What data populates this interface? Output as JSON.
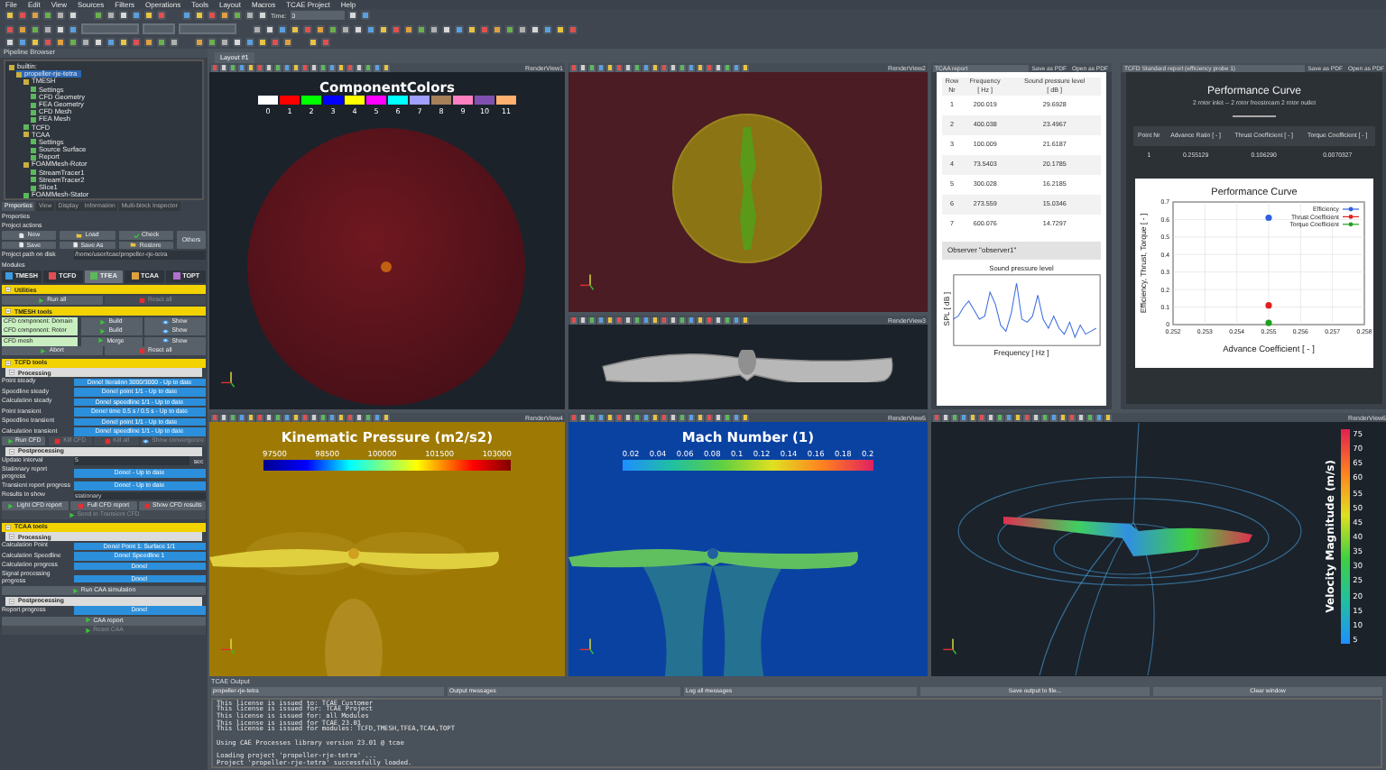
{
  "menu": [
    "File",
    "Edit",
    "View",
    "Sources",
    "Filters",
    "Operations",
    "Tools",
    "Layout",
    "Macros",
    "TCAE Project",
    "Help"
  ],
  "toolbar": {
    "time_label": "Time:",
    "time_value": "0"
  },
  "pipeline": {
    "title": "Pipeline Browser",
    "items": [
      {
        "label": "builtin:",
        "selected": false,
        "children": [
          {
            "label": "propeller-rje-tetra",
            "selected": true,
            "children": [
              {
                "label": "TMESH",
                "selected": false,
                "children": [
                  {
                    "label": "Settings",
                    "selected": false
                  },
                  {
                    "label": "CFD Geometry",
                    "selected": false
                  },
                  {
                    "label": "FEA Geometry",
                    "selected": false
                  },
                  {
                    "label": "CFD Mesh",
                    "selected": false
                  },
                  {
                    "label": "FEA Mesh",
                    "selected": false
                  }
                ]
              },
              {
                "label": "TCFD",
                "selected": false
              },
              {
                "label": "TCAA",
                "selected": false,
                "children": [
                  {
                    "label": "Settings",
                    "selected": false
                  },
                  {
                    "label": "Source Surface",
                    "selected": false
                  },
                  {
                    "label": "Report",
                    "selected": false
                  }
                ]
              },
              {
                "label": "FOAMMesh-Rotor",
                "selected": false,
                "children": [
                  {
                    "label": "StreamTracer1",
                    "selected": false
                  },
                  {
                    "label": "StreamTracer2",
                    "selected": false
                  },
                  {
                    "label": "Slice1",
                    "selected": false
                  }
                ]
              },
              {
                "label": "FOAMMesh-Stator",
                "selected": false
              }
            ]
          }
        ]
      }
    ]
  },
  "properties": {
    "tabs": [
      {
        "label": "Properties",
        "selected": true
      },
      {
        "label": "View",
        "selected": false
      },
      {
        "label": "Display",
        "selected": false
      },
      {
        "label": "Information",
        "selected": false
      },
      {
        "label": "Multi-block Inspector",
        "selected": false
      }
    ],
    "heading": "Properties",
    "actions_label": "Project actions",
    "actions": [
      "New",
      "Load",
      "Check",
      "Save",
      "Save As",
      "Restore"
    ],
    "others": "Others",
    "path_label": "Project path on disk",
    "path_value": "/home/user/tcae/propeller-rje-tetra",
    "modules_label": "Modules",
    "modules": [
      {
        "label": "TMESH",
        "selected": false
      },
      {
        "label": "TCFD",
        "selected": false
      },
      {
        "label": "TFEA",
        "selected": true
      },
      {
        "label": "TCAA",
        "selected": false
      },
      {
        "label": "TOPT",
        "selected": false
      }
    ],
    "sections": [
      {
        "title": "Utilities",
        "rows": [
          {
            "kind": "buttons",
            "buttons": [
              {
                "label": "Run all",
                "disabled": false
              },
              {
                "label": "Reset all",
                "disabled": true
              }
            ]
          }
        ]
      },
      {
        "title": "TMESH tools",
        "rows": [
          {
            "kind": "tool",
            "label": "CFD component: Domain",
            "buttons": [
              {
                "label": "Build",
                "disabled": false
              },
              {
                "label": "Show",
                "disabled": false
              }
            ]
          },
          {
            "kind": "tool",
            "label": "CFD component: Rotor",
            "buttons": [
              {
                "label": "Build",
                "disabled": false
              },
              {
                "label": "Show",
                "disabled": false
              }
            ]
          },
          {
            "kind": "tool",
            "label": "CFD mesh",
            "buttons": [
              {
                "label": "Merge",
                "disabled": false
              },
              {
                "label": "Show",
                "disabled": false
              }
            ]
          },
          {
            "kind": "buttons",
            "buttons": [
              {
                "label": "Abort",
                "disabled": false
              },
              {
                "label": "Reset all",
                "disabled": false
              }
            ]
          }
        ]
      },
      {
        "title": "TCFD tools",
        "rows": [
          {
            "kind": "subheader",
            "label": "Processing"
          },
          {
            "kind": "status",
            "label": "Point steady",
            "value": "Done! Iteration 3000/3000 - Up to date",
            "level": 1
          },
          {
            "kind": "status",
            "label": "Speedline steady",
            "value": "Done! point 1/1 - Up to date",
            "level": 1
          },
          {
            "kind": "status",
            "label": "Calculation steady",
            "value": "Done! speedline 1/1 - Up to date",
            "level": 1
          },
          {
            "kind": "status",
            "label": "Point transient",
            "value": "Done! time 0.5 s / 0.5 s - Up to date",
            "level": 1
          },
          {
            "kind": "status",
            "label": "Speedline transient",
            "value": "Done! point 1/1 - Up to date",
            "level": 1
          },
          {
            "kind": "status",
            "label": "Calculation transient",
            "value": "Done! speedline 1/1 - Up to date",
            "level": 1
          },
          {
            "kind": "buttons",
            "buttons": [
              {
                "label": "Run CFD",
                "disabled": false
              },
              {
                "label": "Kill CFD",
                "disabled": true
              },
              {
                "label": "Kill all",
                "disabled": true
              },
              {
                "label": "Show convergence",
                "disabled": true
              }
            ]
          },
          {
            "kind": "subheader",
            "label": "Postprocessing"
          },
          {
            "kind": "field",
            "label": "Update interval",
            "value": "5",
            "unit": "sec"
          },
          {
            "kind": "status",
            "label": "Stationary report progress",
            "value": "Done! - Up to date",
            "level": 1
          },
          {
            "kind": "status",
            "label": "Transient report progress",
            "value": "Done! - Up to date",
            "level": 1
          },
          {
            "kind": "select",
            "label": "Results to show",
            "value": "stationary"
          },
          {
            "kind": "buttons",
            "buttons": [
              {
                "label": "Light CFD report",
                "disabled": false
              },
              {
                "label": "Full CFD report",
                "disabled": false
              },
              {
                "label": "Show CFD results",
                "disabled": false
              }
            ]
          },
          {
            "kind": "buttons",
            "buttons": [
              {
                "label": "Send to Transient CFD",
                "disabled": true
              }
            ]
          }
        ]
      },
      {
        "title": "TCAA tools",
        "rows": [
          {
            "kind": "subheader",
            "label": "Processing"
          },
          {
            "kind": "status",
            "label": "Calculation Point",
            "value": "Done! Point 1: Surface 1/1",
            "level": 1
          },
          {
            "kind": "status",
            "label": "Calculation Speedline",
            "value": "Done! Speedline 1",
            "level": 1
          },
          {
            "kind": "status",
            "label": "Calculation progress",
            "value": "Done!",
            "level": 1
          },
          {
            "kind": "status",
            "label": "Signal processing progress",
            "value": "Done!",
            "level": 1
          },
          {
            "kind": "buttons",
            "buttons": [
              {
                "label": "Run CAA simulation",
                "disabled": false
              }
            ]
          },
          {
            "kind": "subheader",
            "label": "Postprocessing"
          },
          {
            "kind": "status",
            "label": "Report progress",
            "value": "Done!",
            "level": 1
          },
          {
            "kind": "buttons",
            "buttons": [
              {
                "label": "CAA report",
                "disabled": false
              }
            ]
          },
          {
            "kind": "buttons",
            "buttons": [
              {
                "label": "Reset CAA",
                "disabled": true
              }
            ]
          }
        ]
      }
    ]
  },
  "layout_tabs": [
    {
      "label": "Layout #1",
      "selected": true
    }
  ],
  "views": [
    {
      "kind": "components",
      "toolbar_label": "RenderView1",
      "title": "ComponentColors",
      "swatches": [
        {
          "label": "0",
          "color": "#ffffff"
        },
        {
          "label": "1",
          "color": "#ff0000"
        },
        {
          "label": "2",
          "color": "#00ff00"
        },
        {
          "label": "3",
          "color": "#0000ff"
        },
        {
          "label": "4",
          "color": "#ffff00"
        },
        {
          "label": "5",
          "color": "#ff00ff"
        },
        {
          "label": "6",
          "color": "#00ffff"
        },
        {
          "label": "7",
          "color": "#9f9fff"
        },
        {
          "label": "8",
          "color": "#a57f5a"
        },
        {
          "label": "9",
          "color": "#ff80c0"
        },
        {
          "label": "10",
          "color": "#8050b0"
        },
        {
          "label": "11",
          "color": "#ffb070"
        }
      ]
    },
    {
      "kind": "disc",
      "toolbar_label": "RenderView2"
    },
    {
      "kind": "propeller",
      "toolbar_label": "RenderView3"
    },
    {
      "kind": "pressure",
      "toolbar_label": "RenderView4",
      "title": "Kinematic Pressure (m2/s2)",
      "ticks": [
        "97500",
        "98500",
        "100000",
        "101500",
        "103000"
      ]
    },
    {
      "kind": "mach",
      "toolbar_label": "RenderView5",
      "title": "Mach Number (1)",
      "ticks": [
        "0.02",
        "0.04",
        "0.06",
        "0.08",
        "0.1",
        "0.12",
        "0.14",
        "0.16",
        "0.18",
        "0.2"
      ]
    },
    {
      "kind": "streamlines",
      "toolbar_label": "RenderView6",
      "title": "Velocity Magnitude (m/s)",
      "ticks": [
        "75",
        "70",
        "65",
        "60",
        "55",
        "50",
        "45",
        "40",
        "35",
        "30",
        "25",
        "20",
        "15",
        "10",
        "5"
      ]
    }
  ],
  "table_report": {
    "selector": "TCAA report",
    "buttons": [
      "Save as PDF",
      "Open as PDF"
    ],
    "header_rows": [
      [
        "Row",
        "Frequency",
        "Sound pressure level"
      ],
      [
        "Nr",
        "[ Hz ]",
        "[ dB ]"
      ]
    ],
    "rows": [
      [
        "1",
        "200.019",
        "29.6928"
      ],
      [
        "2",
        "400.038",
        "23.4967"
      ],
      [
        "3",
        "100.009",
        "21.6187"
      ],
      [
        "4",
        "73.5403",
        "20.1785"
      ],
      [
        "5",
        "300.028",
        "16.2185"
      ],
      [
        "6",
        "273.559",
        "15.0346"
      ],
      [
        "7",
        "600.076",
        "14.7297"
      ]
    ],
    "observer": "Observer \"observer1\"",
    "plot_title": "Sound pressure level",
    "plot_xlabel": "Frequency [ Hz ]",
    "plot_ylabel": "SPL [ dB ]"
  },
  "performance_report": {
    "selector": "TCFD Standard report (efficiency probe 1)",
    "buttons": [
      "Save as PDF",
      "Open as PDF"
    ],
    "title": "Performance Curve",
    "subtitle": "2 rotor inlet -- 2 rotor freestream 2 rotor outlet",
    "columns": [
      "Point Nr",
      "Advance Ratio [ - ]",
      "Thrust Coefficient [ - ]",
      "Torque Coefficient [ - ]"
    ],
    "rows": [
      [
        "1",
        "0.255129",
        "0.106290",
        "0.0070327"
      ]
    ],
    "chart_data": {
      "type": "scatter",
      "title": "Performance Curve",
      "xlabel": "Advance Coefficient [ - ]",
      "ylabel": "Efficiency, Thrust, Torque [ - ]",
      "xlim": [
        0.252,
        0.258
      ],
      "ylim": [
        0,
        0.7
      ],
      "grid": true,
      "legend": "upper right",
      "xticks": [
        0.252,
        0.253,
        0.254,
        0.255,
        0.256,
        0.257,
        0.258
      ],
      "yticks": [
        0,
        0.1,
        0.2,
        0.3,
        0.4,
        0.5,
        0.6,
        0.7
      ],
      "x": [
        0.255
      ],
      "series": [
        {
          "name": "Efficiency",
          "color": "#3060e0",
          "values": [
            0.61
          ]
        },
        {
          "name": "Thrust Coefficient",
          "color": "#e02020",
          "values": [
            0.11
          ]
        },
        {
          "name": "Torque Coefficient",
          "color": "#20a020",
          "values": [
            0.01
          ]
        }
      ]
    }
  },
  "output": {
    "title": "TCAE Output",
    "selectors": [
      "propeller-rje-tetra",
      "Output messages",
      "Log all messages"
    ],
    "buttons": [
      "Save output to file...",
      "Clear window"
    ],
    "blocks": [
      [
        "This license is issued to: TCAE Customer",
        "This license is issued for: TCAE Project",
        "This license is issued for: all Modules",
        "This license is issued for TCAE 23.01",
        "This license is issued for modules: TCFD,TMESH,TFEA,TCAA,TOPT"
      ],
      [
        "Using CAE Processes library version 23.01 @ tcae"
      ],
      [
        "Loading project 'propeller-rje-tetra' ...",
        "Project 'propeller-rje-tetra' successfully loaded."
      ]
    ]
  }
}
